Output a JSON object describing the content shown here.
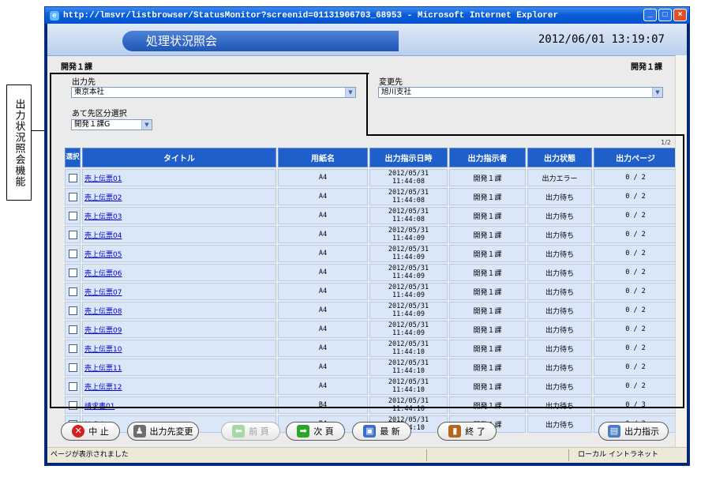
{
  "annotation": {
    "label": "出力状況照会機能"
  },
  "window": {
    "title": "http://lmsvr/listbrowser/StatusMonitor?screenid=01131906703_68953 - Microsoft Internet Explorer",
    "controls": {
      "minimize": "_",
      "maximize": "□",
      "close": "×"
    }
  },
  "header": {
    "title": "処理状況照会",
    "datetime": "2012/06/01 13:19:07"
  },
  "dept": {
    "left": "開発１課",
    "right": "開発１課"
  },
  "filters": {
    "output_dest_label": "出力先",
    "output_dest_value": "東京本社",
    "change_dest_label": "変更先",
    "change_dest_value": "旭川支社",
    "dest_class_label": "あて先区分選択",
    "dest_class_value": "開発１課G"
  },
  "page_indicator": "1/2",
  "table": {
    "headers": {
      "select": "選択",
      "title": "タイトル",
      "paper": "用紙名",
      "datetime": "出力指示日時",
      "instructor": "出力指示者",
      "status": "出力状態",
      "pages": "出力ページ"
    },
    "rows": [
      {
        "title": "売上伝票01",
        "paper": "A4",
        "datetime": "2012/05/31 11:44:08",
        "instructor": "開発１課",
        "status": "出力エラー",
        "pages": "0 / 2"
      },
      {
        "title": "売上伝票02",
        "paper": "A4",
        "datetime": "2012/05/31 11:44:08",
        "instructor": "開発１課",
        "status": "出力待ち",
        "pages": "0 / 2"
      },
      {
        "title": "売上伝票03",
        "paper": "A4",
        "datetime": "2012/05/31 11:44:08",
        "instructor": "開発１課",
        "status": "出力待ち",
        "pages": "0 / 2"
      },
      {
        "title": "売上伝票04",
        "paper": "A4",
        "datetime": "2012/05/31 11:44:09",
        "instructor": "開発１課",
        "status": "出力待ち",
        "pages": "0 / 2"
      },
      {
        "title": "売上伝票05",
        "paper": "A4",
        "datetime": "2012/05/31 11:44:09",
        "instructor": "開発１課",
        "status": "出力待ち",
        "pages": "0 / 2"
      },
      {
        "title": "売上伝票06",
        "paper": "A4",
        "datetime": "2012/05/31 11:44:09",
        "instructor": "開発１課",
        "status": "出力待ち",
        "pages": "0 / 2"
      },
      {
        "title": "売上伝票07",
        "paper": "A4",
        "datetime": "2012/05/31 11:44:09",
        "instructor": "開発１課",
        "status": "出力待ち",
        "pages": "0 / 2"
      },
      {
        "title": "売上伝票08",
        "paper": "A4",
        "datetime": "2012/05/31 11:44:09",
        "instructor": "開発１課",
        "status": "出力待ち",
        "pages": "0 / 2"
      },
      {
        "title": "売上伝票09",
        "paper": "A4",
        "datetime": "2012/05/31 11:44:09",
        "instructor": "開発１課",
        "status": "出力待ち",
        "pages": "0 / 2"
      },
      {
        "title": "売上伝票10",
        "paper": "A4",
        "datetime": "2012/05/31 11:44:10",
        "instructor": "開発１課",
        "status": "出力待ち",
        "pages": "0 / 2"
      },
      {
        "title": "売上伝票11",
        "paper": "A4",
        "datetime": "2012/05/31 11:44:10",
        "instructor": "開発１課",
        "status": "出力待ち",
        "pages": "0 / 2"
      },
      {
        "title": "売上伝票12",
        "paper": "A4",
        "datetime": "2012/05/31 11:44:10",
        "instructor": "開発１課",
        "status": "出力待ち",
        "pages": "0 / 2"
      },
      {
        "title": "請求書01",
        "paper": "B4",
        "datetime": "2012/05/31 11:44:10",
        "instructor": "開発１課",
        "status": "出力待ち",
        "pages": "0 / 3"
      },
      {
        "title": "請求書02",
        "paper": "B4",
        "datetime": "2012/05/31 11:44:10",
        "instructor": "開発１課",
        "status": "出力待ち",
        "pages": "0 / 3"
      }
    ]
  },
  "buttons": {
    "stop": "中 止",
    "change_dest": "出力先変更",
    "prev": "前 頁",
    "next": "次 頁",
    "refresh": "最 新",
    "exit": "終 了",
    "output_instruct": "出力指示"
  },
  "statusbar": {
    "left": "ページが表示されました",
    "right": "ローカル イントラネット"
  }
}
